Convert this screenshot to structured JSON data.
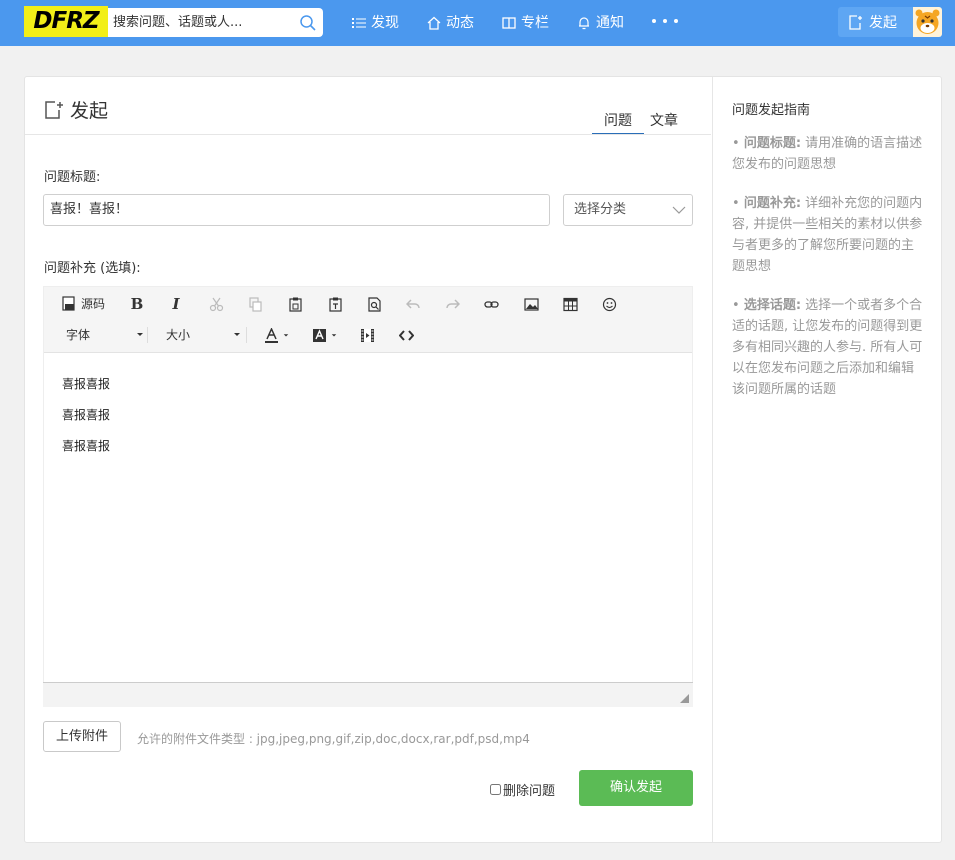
{
  "header": {
    "logo": "DFRZ",
    "search_placeholder": "搜索问题、话题或人...",
    "nav": [
      {
        "label": "发现",
        "icon": "list-icon"
      },
      {
        "label": "动态",
        "icon": "home-icon"
      },
      {
        "label": "专栏",
        "icon": "book-icon"
      },
      {
        "label": "通知",
        "icon": "bell-icon"
      }
    ],
    "more_icon": "more-dots-icon",
    "publish_label": "发起"
  },
  "page": {
    "title": "发起",
    "tabs": [
      {
        "label": "问题",
        "active": true
      },
      {
        "label": "文章",
        "active": false
      }
    ],
    "title_label": "问题标题:",
    "title_value": "喜报！喜报！",
    "category_placeholder": "选择分类",
    "supplement_label": "问题补充 (选填):",
    "editor": {
      "source_label": "源码",
      "font_label": "字体",
      "size_label": "大小",
      "content_lines": [
        "喜报喜报",
        "喜报喜报",
        "喜报喜报"
      ]
    },
    "upload_label": "上传附件",
    "allowed_types": "允许的附件文件类型 : jpg,jpeg,png,gif,zip,doc,docx,rar,pdf,psd,mp4",
    "delete_label": "删除问题",
    "confirm_label": "确认发起"
  },
  "sidebar": {
    "title": "问题发起指南",
    "guides": [
      {
        "head": "问题标题:",
        "text": "请用准确的语言描述您发布的问题思想"
      },
      {
        "head": "问题补充:",
        "text": "详细补充您的问题内容, 并提供一些相关的素材以供参与者更多的了解您所要问题的主题思想"
      },
      {
        "head": "选择话题:",
        "text": "选择一个或者多个合适的话题, 让您发布的问题得到更多有相同兴趣的人参与. 所有人可以在您发布问题之后添加和编辑该问题所属的话题"
      }
    ]
  },
  "colors": {
    "header_bg": "#4b98ee",
    "logo_bg": "#f2ef18",
    "confirm_bg": "#5bbb55",
    "tab_active": "#2a6eb8"
  }
}
